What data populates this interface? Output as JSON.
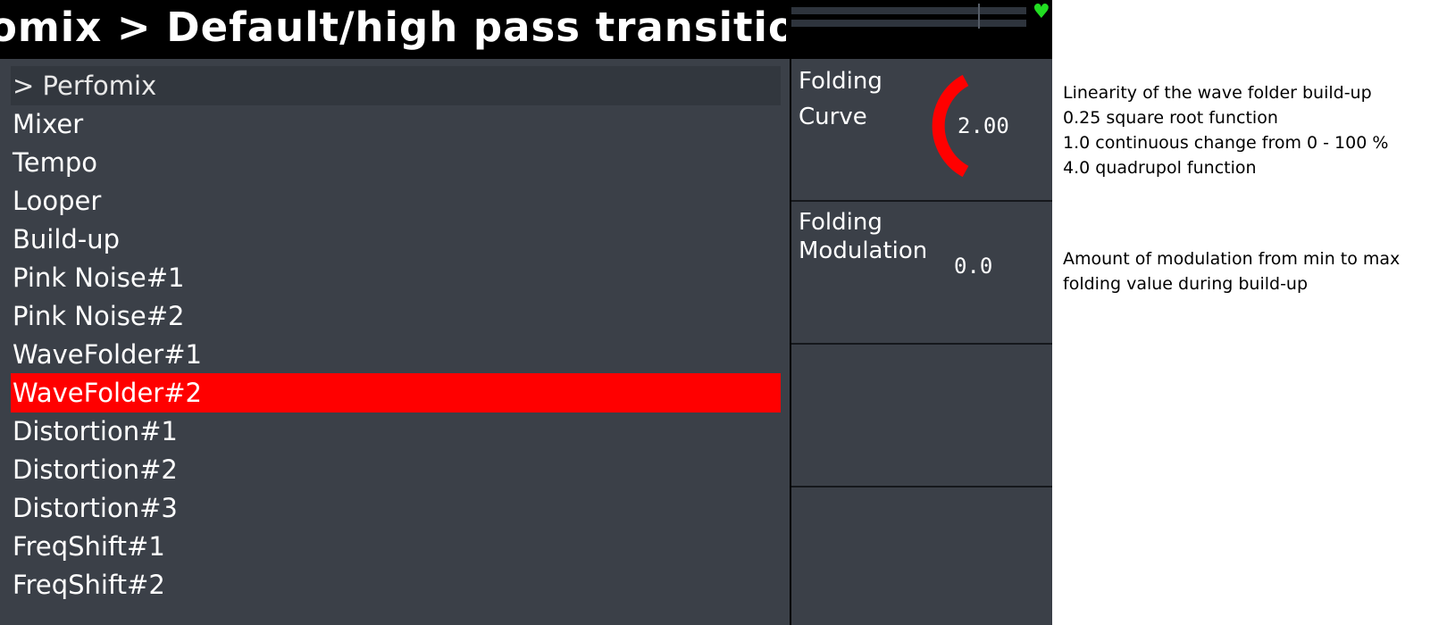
{
  "title": "omix > Default/high pass transitio",
  "menu": {
    "items": [
      {
        "label": "> Perfomix"
      },
      {
        "label": "Mixer"
      },
      {
        "label": "Tempo"
      },
      {
        "label": "Looper"
      },
      {
        "label": "Build-up"
      },
      {
        "label": "Pink Noise#1"
      },
      {
        "label": "Pink Noise#2"
      },
      {
        "label": "WaveFolder#1"
      },
      {
        "label": "WaveFolder#2"
      },
      {
        "label": "Distortion#1"
      },
      {
        "label": "Distortion#2"
      },
      {
        "label": "Distortion#3"
      },
      {
        "label": "FreqShift#1"
      },
      {
        "label": "FreqShift#2"
      }
    ],
    "selected_index": 8
  },
  "params": [
    {
      "label_line1": "Folding",
      "label_line2": "Curve",
      "value": "2.00",
      "knob_color": "#ff0000"
    },
    {
      "label_line1": "Folding",
      "label_line2": "Modulation",
      "value": "0.0"
    }
  ],
  "help": {
    "curve_lines": [
      "Linearity of the wave folder build-up",
      "0.25 square root function",
      "1.0 continuous change from 0 - 100 %",
      "4.0 quadrupol function"
    ],
    "modulation_lines": [
      "Amount of modulation from min to max",
      "folding value during build-up"
    ]
  },
  "icons": {
    "status": "heart-icon"
  },
  "colors": {
    "accent": "#ff0000",
    "panel": "#3b4048",
    "status_ok": "#22dd22"
  }
}
